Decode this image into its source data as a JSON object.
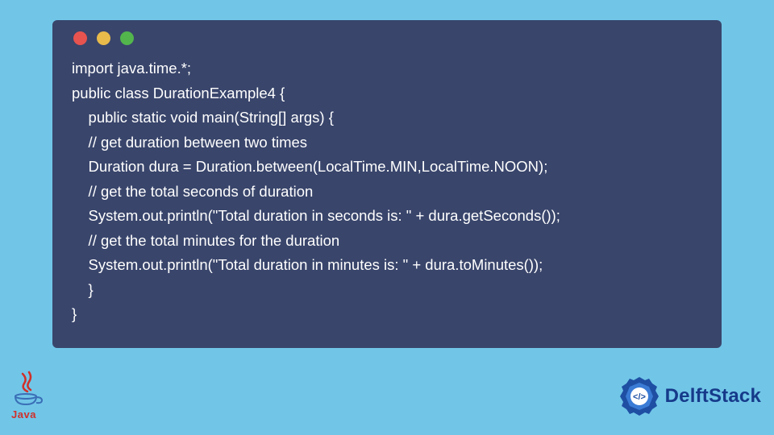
{
  "code": {
    "lines": [
      "import java.time.*;",
      "public class DurationExample4 {",
      "    public static void main(String[] args) {",
      "    // get duration between two times",
      "    Duration dura = Duration.between(LocalTime.MIN,LocalTime.NOON);",
      "    // get the total seconds of duration",
      "    System.out.println(\"Total duration in seconds is: \" + dura.getSeconds());",
      "    // get the total minutes for the duration",
      "    System.out.println(\"Total duration in minutes is: \" + dura.toMinutes());",
      "    }",
      "}"
    ]
  },
  "branding": {
    "java_label": "Java",
    "delft_label": "DelftStack"
  },
  "colors": {
    "page_bg": "#71c6e8",
    "window_bg": "#39456b",
    "dot_red": "#e7534f",
    "dot_yellow": "#e8bb4b",
    "dot_green": "#52b64d",
    "delft_blue": "#163a8a",
    "java_red": "#d0302a"
  }
}
